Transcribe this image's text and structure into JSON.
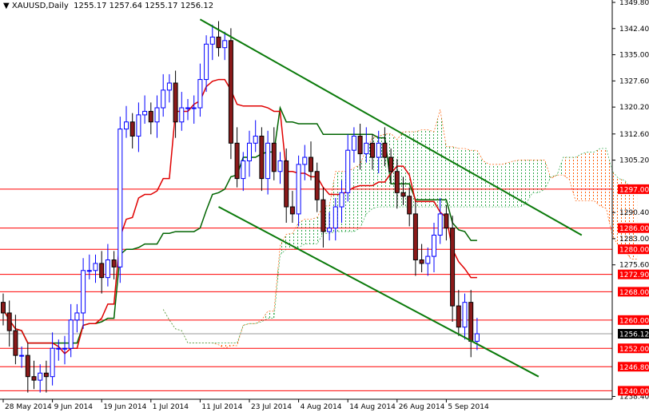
{
  "header": {
    "symbol_timeframe": "XAUUSD,Daily",
    "ohlc": "1255.17 1257.64 1255.17 1256.12"
  },
  "colors": {
    "bull": "#0000ff",
    "bear": "#8b1a1a",
    "tenkan": "#e00000",
    "kijun": "#006400",
    "cloud_bear": "#ff5a00",
    "cloud_bull": "#2ea84a",
    "level": "#ff0000",
    "trend": "#0a7a0a"
  },
  "chart_data": {
    "type": "candlestick",
    "title": "XAUUSD,Daily",
    "ylim": [
      1236.5,
      1350.5
    ],
    "y_ticks": [
      "1349.80",
      "1342.40",
      "1335.00",
      "1327.60",
      "1320.20",
      "1312.60",
      "1305.20",
      "1290.40",
      "1283.00",
      "1275.60",
      "1238.40"
    ],
    "x_tick_labels": [
      {
        "label": "28 May 2014",
        "index": 0
      },
      {
        "label": "9 Jun 2014",
        "index": 8
      },
      {
        "label": "19 Jun 2014",
        "index": 16
      },
      {
        "label": "1 Jul 2014",
        "index": 24
      },
      {
        "label": "11 Jul 2014",
        "index": 32
      },
      {
        "label": "23 Jul 2014",
        "index": 40
      },
      {
        "label": "4 Aug 2014",
        "index": 48
      },
      {
        "label": "14 Aug 2014",
        "index": 56
      },
      {
        "label": "26 Aug 2014",
        "index": 64
      },
      {
        "label": "5 Sep 2014",
        "index": 72
      }
    ],
    "closes": [
      1262,
      1257,
      1250,
      1250,
      1244,
      1243,
      1245,
      1244,
      1252,
      1252,
      1252,
      1260,
      1262,
      1274,
      1274,
      1276,
      1272,
      1277,
      1275,
      1314,
      1316,
      1312,
      1318,
      1319,
      1316,
      1320,
      1325,
      1327,
      1316,
      1320,
      1320,
      1320,
      1328,
      1338,
      1340,
      1337,
      1339,
      1310,
      1300,
      1305,
      1310,
      1312,
      1300,
      1310,
      1302,
      1305,
      1292,
      1290,
      1304,
      1306,
      1302,
      1294,
      1285,
      1286,
      1292,
      1296,
      1308,
      1312,
      1307,
      1310,
      1306,
      1310,
      1306,
      1302,
      1296,
      1295,
      1290,
      1277,
      1276,
      1278,
      1284,
      1290,
      1286,
      1264,
      1258,
      1265,
      1254,
      1256.12
    ],
    "levels": [
      {
        "label": "1297.00",
        "price": 1297.0
      },
      {
        "label": "1286.00",
        "price": 1286.0
      },
      {
        "label": "1280.00",
        "price": 1280.0
      },
      {
        "label": "1272.90",
        "price": 1272.9
      },
      {
        "label": "1268.00",
        "price": 1268.0
      },
      {
        "label": "1260.00",
        "price": 1260.0
      },
      {
        "label": "1252.00",
        "price": 1252.0
      },
      {
        "label": "1246.80",
        "price": 1246.8
      },
      {
        "label": "1240.00",
        "price": 1240.0
      }
    ],
    "current_price": {
      "label": "1256.12",
      "price": 1256.12
    },
    "indicators": [
      "Ichimoku (tenkan 9, kijun 26, senkou 52)"
    ],
    "trendlines": [
      {
        "name": "upper",
        "from": {
          "index": 32,
          "price": 1345
        },
        "to": {
          "index": 94,
          "price": 1284
        }
      },
      {
        "name": "lower",
        "from": {
          "index": 35,
          "price": 1292
        },
        "to": {
          "index": 87,
          "price": 1244
        }
      }
    ]
  }
}
